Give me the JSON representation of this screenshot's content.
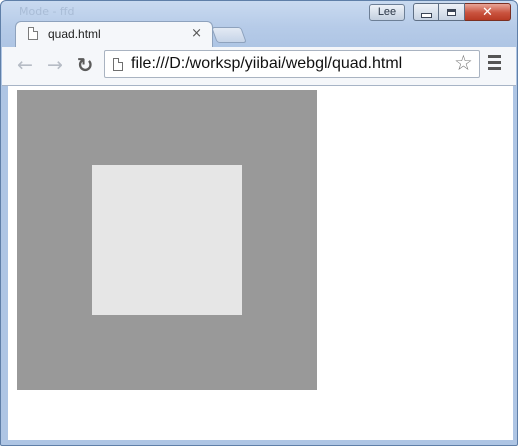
{
  "window": {
    "faded_title": "Mode - ffd",
    "user_badge": "Lee",
    "caption": {
      "minimize_icon": "minimize-icon",
      "maximize_icon": "maximize-icon",
      "close_icon": "close-icon",
      "close_glyph": "✕"
    }
  },
  "tabs": [
    {
      "title": "quad.html",
      "icon": "page-icon",
      "close_glyph": "×",
      "active": true
    }
  ],
  "toolbar": {
    "back_glyph": "←",
    "forward_glyph": "→",
    "reload_glyph": "↻",
    "url": "file:///D:/worksp/yiibai/webgl/quad.html",
    "bookmark_glyph": "☆",
    "menu_icon": "hamburger-menu-icon"
  },
  "content": {
    "canvas_color": "#999999",
    "quad_color": "#e6e6e6",
    "page_background": "#ffffff"
  }
}
